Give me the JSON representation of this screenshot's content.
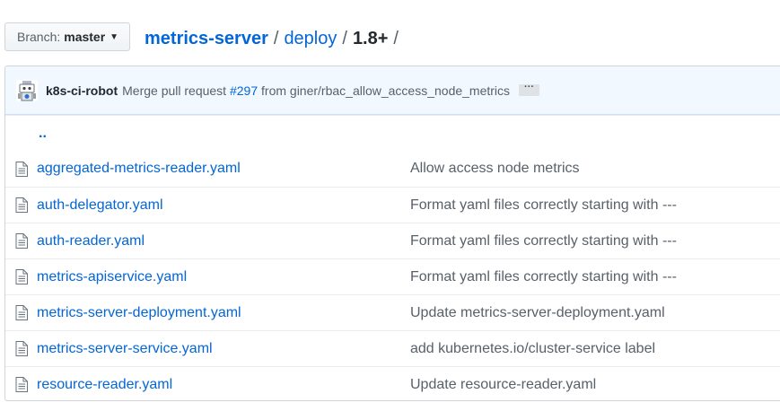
{
  "branch": {
    "label": "Branch:",
    "value": "master"
  },
  "breadcrumb": {
    "root": "metrics-server",
    "sep1": "/",
    "dir": "deploy",
    "sep2": "/",
    "current": "1.8+",
    "sep3": "/"
  },
  "commit": {
    "author": "k8s-ci-robot",
    "message_prefix": "Merge pull request",
    "pr": "#297",
    "message_suffix": "from giner/rbac_allow_access_node_metrics",
    "more": "···"
  },
  "parent_link": "..",
  "files": [
    {
      "name": "aggregated-metrics-reader.yaml",
      "message": "Allow access node metrics"
    },
    {
      "name": "auth-delegator.yaml",
      "message": "Format yaml files correctly starting with ---"
    },
    {
      "name": "auth-reader.yaml",
      "message": "Format yaml files correctly starting with ---"
    },
    {
      "name": "metrics-apiservice.yaml",
      "message": "Format yaml files correctly starting with ---"
    },
    {
      "name": "metrics-server-deployment.yaml",
      "message": "Update metrics-server-deployment.yaml"
    },
    {
      "name": "metrics-server-service.yaml",
      "message": "add kubernetes.io/cluster-service label"
    },
    {
      "name": "resource-reader.yaml",
      "message": "Update resource-reader.yaml"
    }
  ],
  "colors": {
    "link": "#0366d6",
    "muted": "#586069",
    "commit_bg": "#f1f8ff"
  },
  "icons": {
    "file": "file-icon",
    "caret": "caret-down-icon",
    "avatar": "robot-avatar"
  }
}
